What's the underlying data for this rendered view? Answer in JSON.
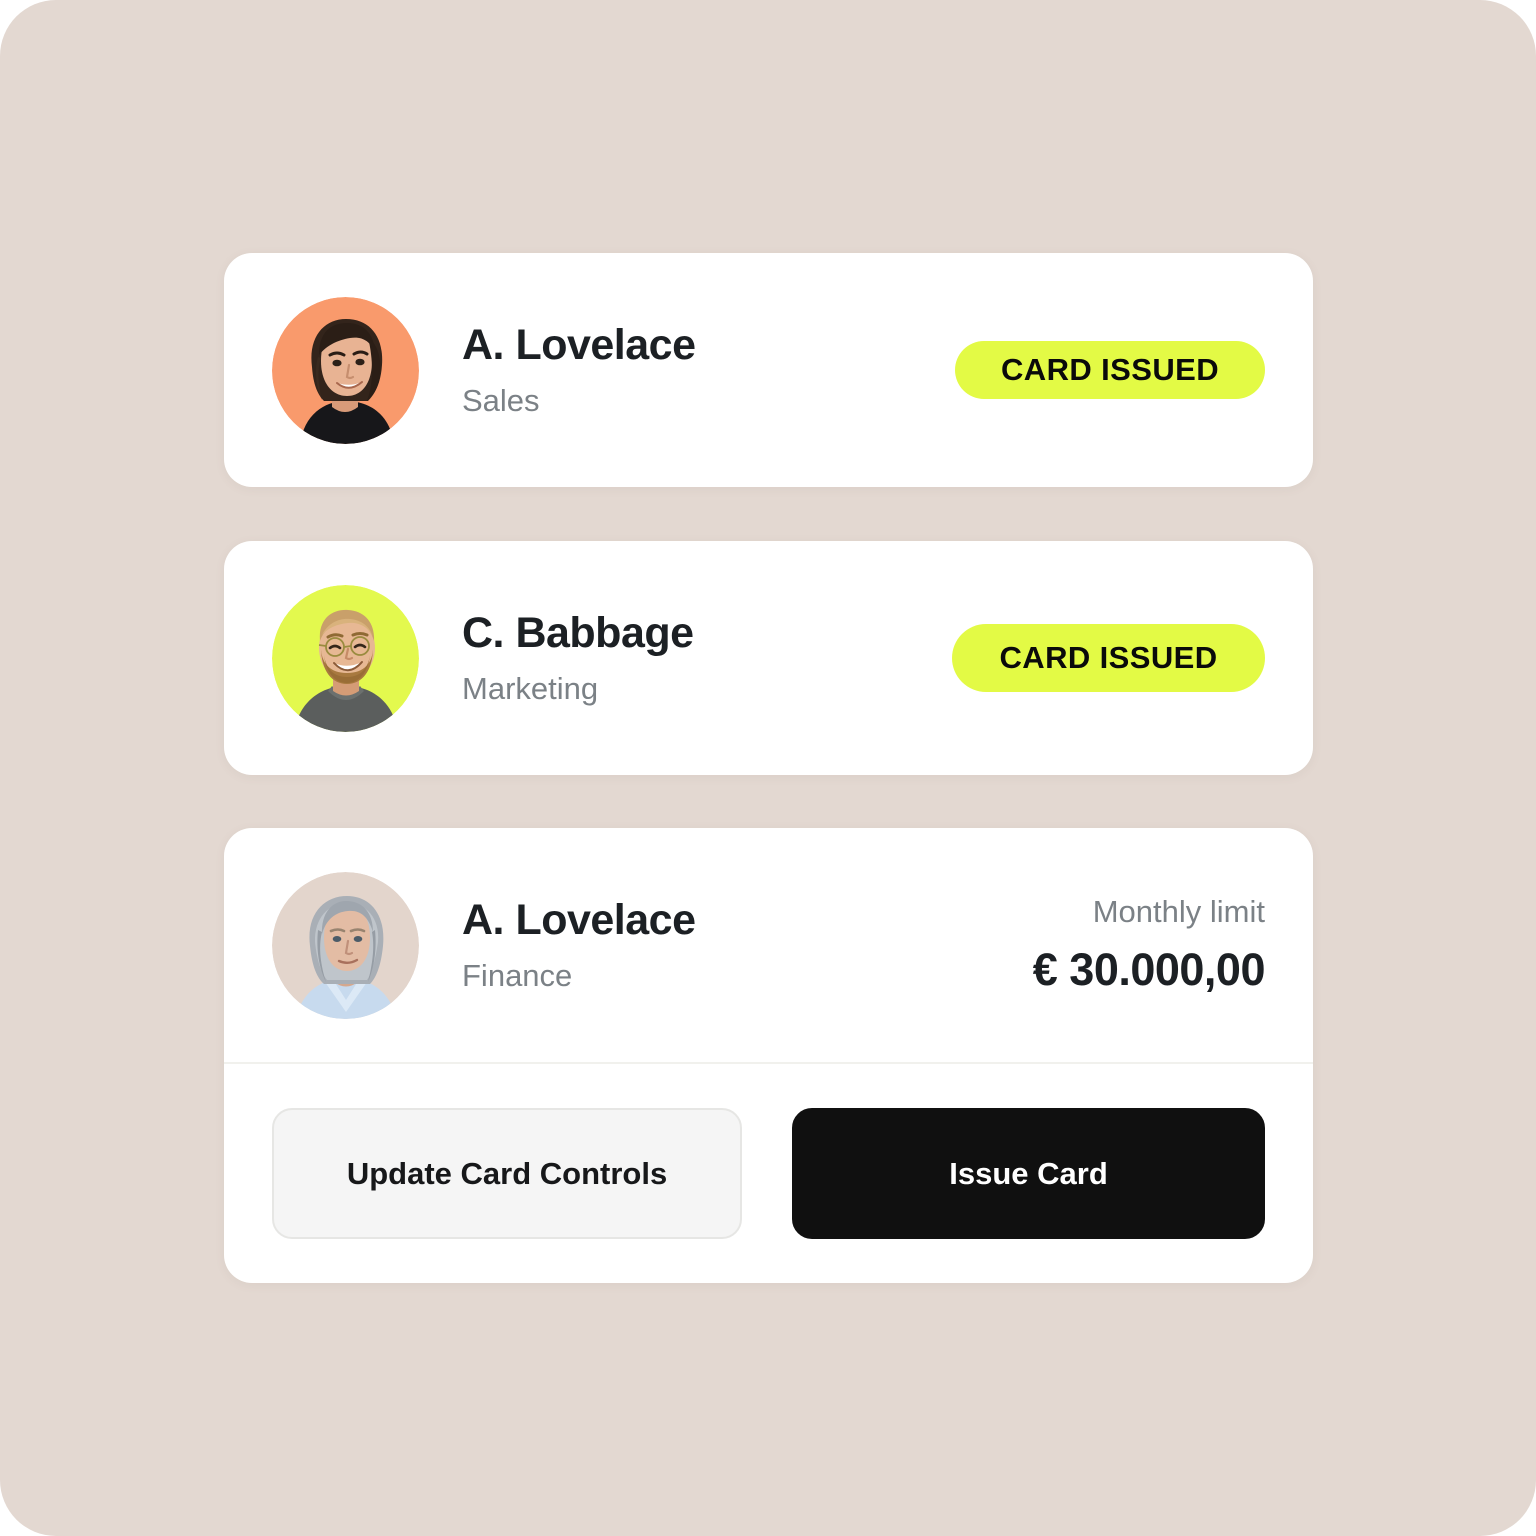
{
  "theme": {
    "page_background": "#E3D8D1",
    "card_background": "#FFFFFF",
    "badge_background": "#E3FA45",
    "badge_text": "#0A0A0A",
    "name_text": "#1C2024",
    "muted_text": "#7B8186",
    "divider": "#F1F1ED",
    "primary_button_bg": "#101010",
    "primary_button_text": "#FFFFFF",
    "secondary_button_bg": "#F5F5F5",
    "secondary_button_border": "#E6E6E4"
  },
  "cards": [
    {
      "id": "card-1",
      "avatar": {
        "icon": "avatar-photo-woman-dark-hair",
        "background_color": "#F99A6C",
        "skin": "#E8B393",
        "hair": "#2E2119",
        "clothing": "#1A1A1D"
      },
      "name": "A. Lovelace",
      "role": "Sales",
      "status_badge": "CARD ISSUED"
    },
    {
      "id": "card-2",
      "avatar": {
        "icon": "avatar-photo-man-beard-glasses",
        "background_color": "#E3F94E",
        "skin": "#E7B894",
        "hair": "#C9A06A",
        "beard": "#A8793F",
        "clothing": "#5A5D5C"
      },
      "name": "C. Babbage",
      "role": "Marketing",
      "status_badge": "CARD ISSUED"
    },
    {
      "id": "card-3",
      "avatar": {
        "icon": "avatar-photo-woman-gray-hair",
        "background_color": "#E3D5CC",
        "skin": "#E3BCA4",
        "hair": "#A9AFB6",
        "clothing": "#C5D9EC"
      },
      "name": "A. Lovelace",
      "role": "Finance",
      "limit_label": "Monthly limit",
      "limit_value": "€ 30.000,00",
      "actions": {
        "secondary_label": "Update Card Controls",
        "primary_label": "Issue Card"
      }
    }
  ]
}
